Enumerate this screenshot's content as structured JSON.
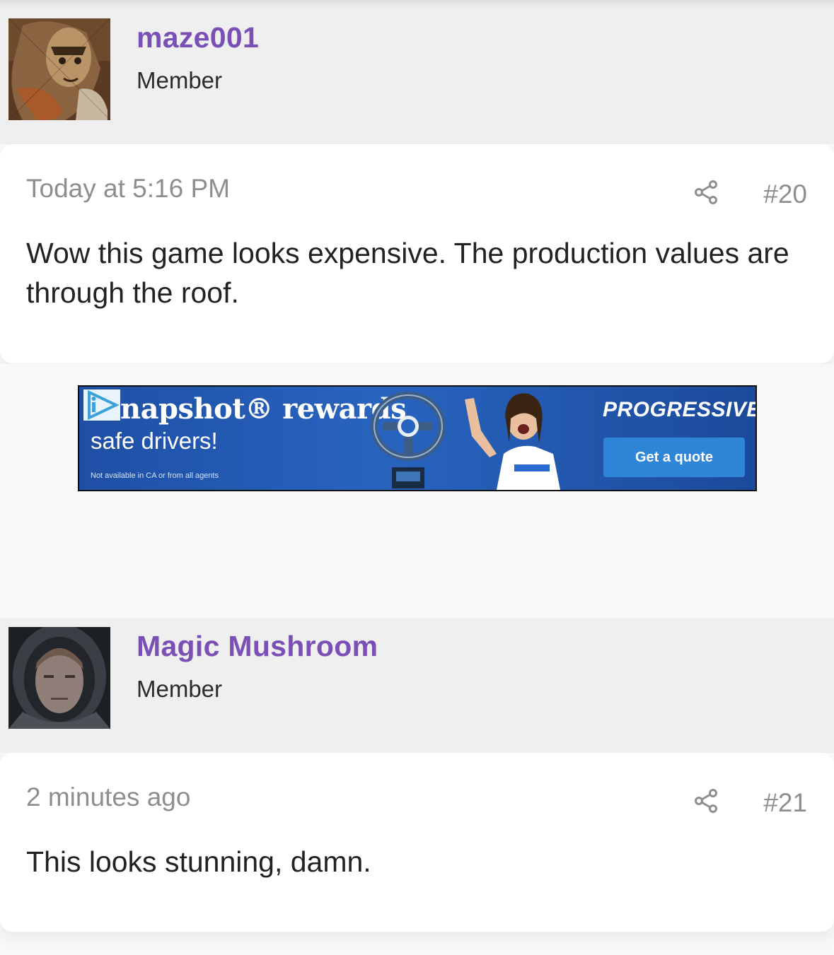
{
  "posts": [
    {
      "author": "maze001",
      "role": "Member",
      "time": "Today at 5:16 PM",
      "number": "#20",
      "body": "Wow this game looks expensive. The production values are through the roof."
    },
    {
      "author": "Magic Mushroom",
      "role": "Member",
      "time": "2 minutes ago",
      "number": "#21",
      "body": "This looks stunning, damn."
    }
  ],
  "ad": {
    "headline": "napshot® rewards",
    "subline": "safe drivers!",
    "disclaimer": "Not available in CA or from all agents",
    "brand": "PROGRESSIVE",
    "cta": "Get a quote"
  },
  "colors": {
    "username": "#7a4fb6",
    "header_bg": "#efefef",
    "meta_text": "#8e8e8e"
  }
}
